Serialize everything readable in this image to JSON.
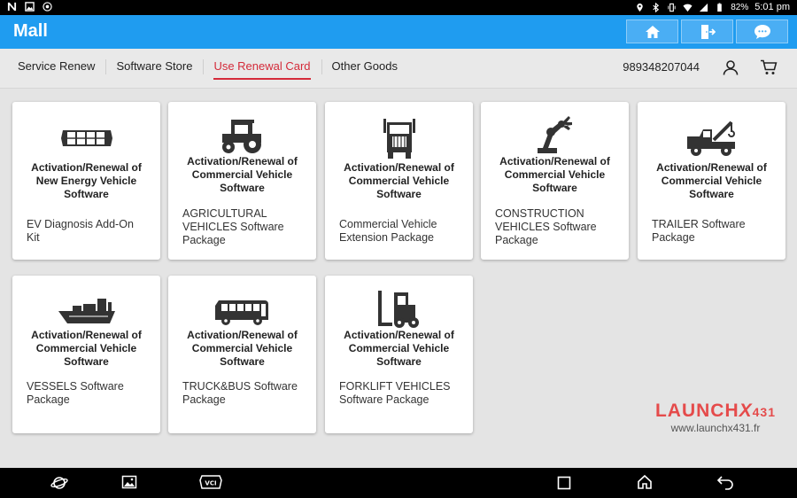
{
  "status_bar": {
    "battery": "82%",
    "time": "5:01 pm"
  },
  "app": {
    "title": "Mall"
  },
  "tabs": [
    {
      "label": "Service Renew",
      "active": false
    },
    {
      "label": "Software Store",
      "active": false
    },
    {
      "label": "Use Renewal Card",
      "active": true
    },
    {
      "label": "Other Goods",
      "active": false
    }
  ],
  "account": {
    "number": "989348207044"
  },
  "cards": [
    {
      "icon": "ev-battery-icon",
      "heading": [
        "Activation/Renewal of",
        "New Energy Vehicle",
        "Software"
      ],
      "sub": [
        "EV Diagnosis Add-On",
        "Kit"
      ]
    },
    {
      "icon": "tractor-icon",
      "heading": [
        "Activation/Renewal of",
        "Commercial Vehicle",
        "Software"
      ],
      "sub": [
        "AGRICULTURAL",
        "VEHICLES Software",
        "Package"
      ]
    },
    {
      "icon": "truck-front-icon",
      "heading": [
        "Activation/Renewal of",
        "Commercial Vehicle",
        "Software"
      ],
      "sub": [
        "Commercial Vehicle",
        "Extension Package"
      ]
    },
    {
      "icon": "robot-arm-icon",
      "heading": [
        "Activation/Renewal of",
        "Commercial Vehicle",
        "Software"
      ],
      "sub": [
        "CONSTRUCTION",
        "VEHICLES Software",
        "Package"
      ]
    },
    {
      "icon": "tow-truck-icon",
      "heading": [
        "Activation/Renewal of",
        "Commercial Vehicle",
        "Software"
      ],
      "sub": [
        "TRAILER Software",
        "Package"
      ]
    },
    {
      "icon": "ship-icon",
      "heading": [
        "Activation/Renewal of",
        "Commercial Vehicle",
        "Software"
      ],
      "sub": [
        "VESSELS Software",
        "Package"
      ]
    },
    {
      "icon": "bus-icon",
      "heading": [
        "Activation/Renewal of",
        "Commercial Vehicle",
        "Software"
      ],
      "sub": [
        "TRUCK&BUS Software",
        "Package"
      ]
    },
    {
      "icon": "forklift-icon",
      "heading": [
        "Activation/Renewal of",
        "Commercial Vehicle",
        "Software"
      ],
      "sub": [
        "FORKLIFT VEHICLES",
        "Software Package"
      ]
    }
  ],
  "watermark": {
    "brand_a": "LAUNCH",
    "brand_b": "X",
    "brand_c": "431",
    "url": "www.launchx431.fr"
  },
  "colors": {
    "appbar": "#1f9cf0",
    "active_tab": "#d42b3a",
    "watermark": "#e54b4b"
  }
}
